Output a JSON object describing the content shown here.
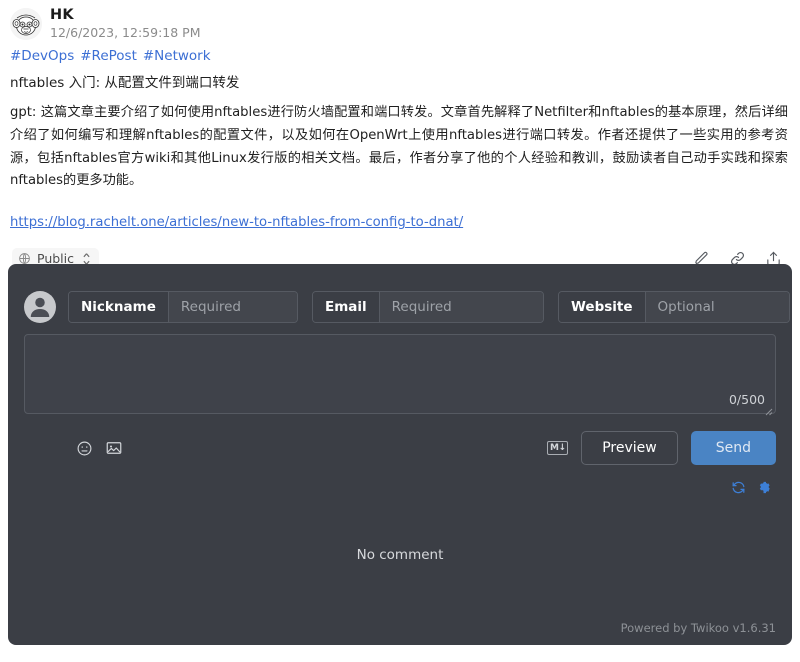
{
  "post": {
    "author": "HK",
    "timestamp": "12/6/2023, 12:59:18 PM",
    "avatar_icon": "monkey-avatar-icon",
    "tags": [
      "#DevOps",
      "#RePost",
      "#Network"
    ],
    "title": "nftables 入门: 从配置文件到端口转发",
    "body": "gpt: 这篇文章主要介绍了如何使用nftables进行防火墙配置和端口转发。文章首先解释了Netfilter和nftables的基本原理，然后详细介绍了如何编写和理解nftables的配置文件，以及如何在OpenWrt上使用nftables进行端口转发。作者还提供了一些实用的参考资源，包括nftables官方wiki和其他Linux发行版的相关文档。最后，作者分享了他的个人经验和教训，鼓励读者自己动手实践和探索nftables的更多功能。",
    "link": "https://blog.rachelt.one/articles/new-to-nftables-from-config-to-dnat/",
    "link_color": "#3c6fd4",
    "tag_color": "#3c6fd4"
  },
  "meta": {
    "visibility_label": "Public",
    "visibility_icon": "globe-icon",
    "selector_icon": "up-down-chevron-icon",
    "actions": [
      {
        "name": "edit-icon",
        "title": "Edit"
      },
      {
        "name": "link-icon",
        "title": "Copy link"
      },
      {
        "name": "share-icon",
        "title": "Share"
      }
    ]
  },
  "comment_form": {
    "avatar_icon": "default-user-avatar-icon",
    "fields": [
      {
        "label": "Nickname",
        "placeholder": "Required",
        "value": ""
      },
      {
        "label": "Email",
        "placeholder": "Required",
        "value": ""
      },
      {
        "label": "Website",
        "placeholder": "Optional",
        "value": ""
      }
    ],
    "textarea_value": "",
    "textarea_placeholder": "",
    "char_count": "0/500",
    "tools": [
      {
        "name": "emoji-icon"
      },
      {
        "name": "image-icon"
      }
    ],
    "markdown_badge": "M↓",
    "preview_label": "Preview",
    "send_label": "Send",
    "send_color": "#4a84c4",
    "sub_icons": [
      {
        "name": "refresh-icon"
      },
      {
        "name": "gear-icon"
      }
    ],
    "sub_icon_color": "#3d7fd6"
  },
  "comments": {
    "empty_text": "No comment",
    "powered_by": "Powered by Twikoo v1.6.31"
  },
  "panel": {
    "background": "#3b3e45"
  }
}
